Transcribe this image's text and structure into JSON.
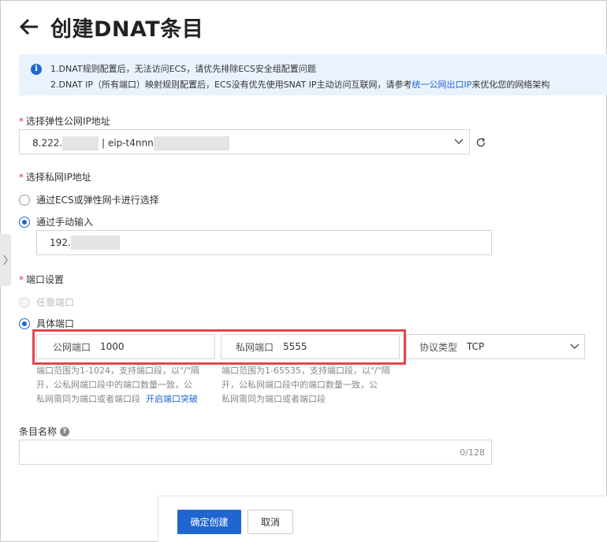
{
  "header": {
    "title": "创建DNAT条目"
  },
  "notice": {
    "line1": "1.DNAT规则配置后，无法访问ECS，请优先排除ECS安全组配置问题",
    "line2_prefix": "2.DNAT IP（所有端口）映射规则配置后，ECS没有优先使用SNAT IP主动访问互联网，请参考",
    "line2_link": "统一公网出口IP",
    "line2_suffix": "来优化您的网络架构"
  },
  "eip": {
    "label": "选择弹性公网IP地址",
    "value_prefix": "8.222.",
    "value_mid": "| eip-t4nnn"
  },
  "private_ip": {
    "label": "选择私网IP地址",
    "option_ecs": "通过ECS或弹性网卡进行选择",
    "option_manual": "通过手动输入",
    "value_prefix": "192."
  },
  "port": {
    "label": "端口设置",
    "option_any": "任意端口",
    "option_specific": "具体端口",
    "public_label": "公网端口",
    "public_value": "1000",
    "private_label": "私网端口",
    "private_value": "5555",
    "protocol_label": "协议类型",
    "protocol_value": "TCP",
    "public_help_1": "端口范围为1-1024，支持端口段，以\"/\"隔",
    "public_help_2": "开，公私网端口段中的端口数量一致，公",
    "public_help_3": "私网需同为端口或者端口段",
    "public_help_link": "开启端口突破",
    "private_help_1": "端口范围为1-65535，支持端口段，以\"/\"隔",
    "private_help_2": "开，公私网端口段中的端口数量一致，公",
    "private_help_3": "私网需同为端口或者端口段"
  },
  "entry_name": {
    "label": "条目名称",
    "help_icon": "?",
    "counter": "0/128"
  },
  "footer": {
    "confirm_label": "确定创建",
    "cancel_label": "取消"
  },
  "colors": {
    "primary": "#1f66d1",
    "notice_bg": "#e9f3fd",
    "highlight_border": "#e0474f",
    "required": "#ee3344"
  }
}
